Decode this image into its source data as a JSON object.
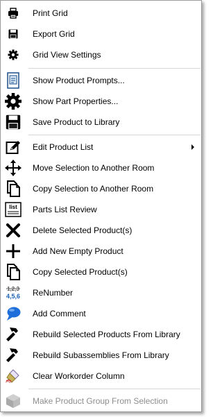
{
  "menu": {
    "items": [
      {
        "label": "Print Grid",
        "icon": "printer-icon"
      },
      {
        "label": "Export Grid",
        "icon": "floppy-disk-icon"
      },
      {
        "label": "Grid View Settings",
        "icon": "gear-icon"
      },
      {
        "label": "Show Product Prompts...",
        "icon": "document-prompt-icon"
      },
      {
        "label": "Show Part Properties...",
        "icon": "gear-large-icon"
      },
      {
        "label": "Save Product to Library",
        "icon": "floppy-disk-large-icon"
      },
      {
        "label": "Edit Product List",
        "icon": "edit-pencil-icon",
        "submenu": true
      },
      {
        "label": "Move Selection to Another Room",
        "icon": "move-arrows-icon"
      },
      {
        "label": "Copy Selection to Another Room",
        "icon": "copy-pages-icon"
      },
      {
        "label": "Parts List Review",
        "icon": "list-icon",
        "icon_text": "list"
      },
      {
        "label": "Delete Selected Product(s)",
        "icon": "delete-x-icon"
      },
      {
        "label": "Add New Empty Product",
        "icon": "plus-icon"
      },
      {
        "label": "Copy Selected Product(s)",
        "icon": "copy-pages-icon"
      },
      {
        "label": "ReNumber",
        "icon": "renumber-icon",
        "icon_text_top": "1,2,3",
        "icon_text_bottom": "4,5,6"
      },
      {
        "label": "Add Comment",
        "icon": "comment-bubble-icon"
      },
      {
        "label": "Rebuild Selected Products From Library",
        "icon": "hammer-icon"
      },
      {
        "label": "Rebuild Subassemblies From Library",
        "icon": "hammer-icon"
      },
      {
        "label": "Clear Workorder Column",
        "icon": "eraser-brush-icon"
      },
      {
        "label": "Make Product Group From Selection",
        "icon": "cube-icon",
        "disabled": true
      }
    ],
    "colors": {
      "comment_blue": "#1e6fd9",
      "renumber_blue": "#1a5fb4",
      "disabled_text": "#8d8d8d"
    }
  }
}
